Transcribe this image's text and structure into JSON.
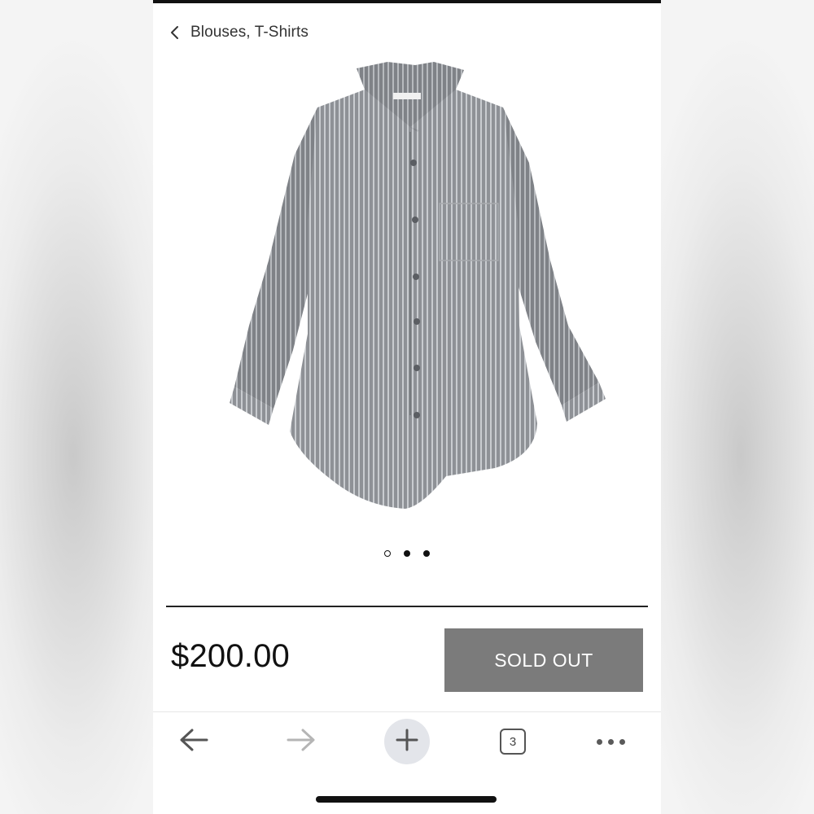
{
  "nav": {
    "back_label": "Blouses, T-Shirts"
  },
  "product": {
    "price": "$200.00",
    "status_button_label": "SOLD OUT",
    "image_description": "gray striped button-up shirt",
    "carousel": {
      "total_slides": 3,
      "active_index": 0
    }
  },
  "toolbar": {
    "tab_count": "3",
    "items": [
      "back-arrow-icon",
      "forward-arrow-icon",
      "plus-icon",
      "tabs-icon",
      "more-icon"
    ]
  },
  "colors": {
    "sold_out_bg": "#7b7b7b",
    "shirt": "#8c8f94",
    "new_tab_bg": "#e3e5ea"
  }
}
